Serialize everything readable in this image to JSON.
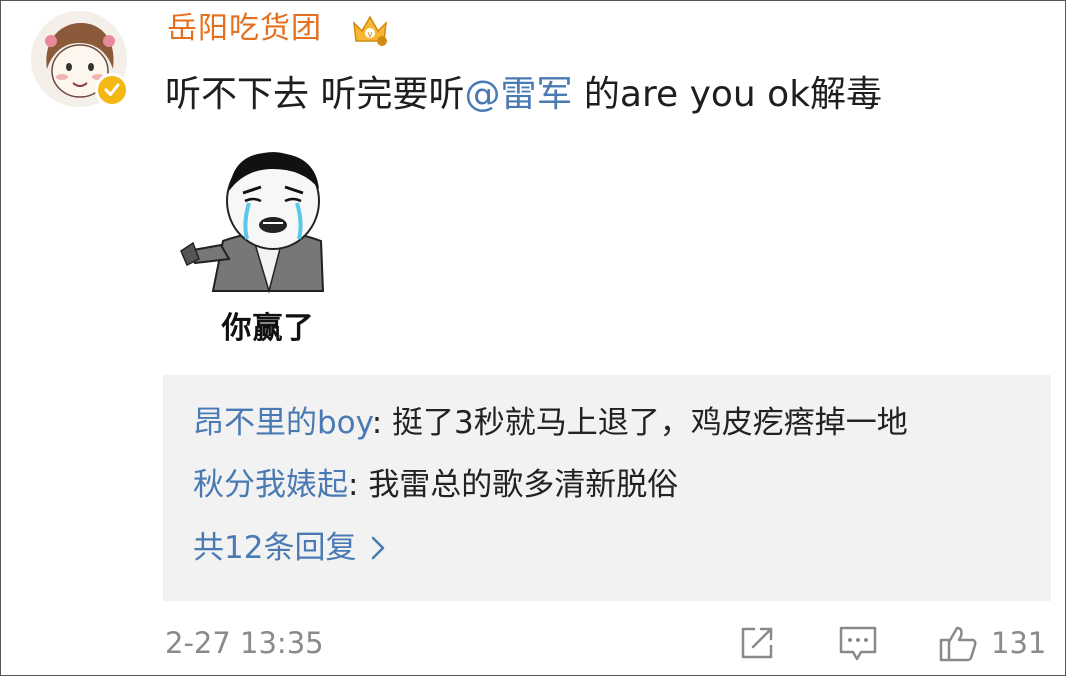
{
  "post": {
    "username": "岳阳吃货团",
    "text_prefix": "听不下去 听完要听",
    "mention": "@雷军",
    "text_suffix": " 的are you ok解毒",
    "meme_caption": "你赢了",
    "timestamp": "2-27 13:35",
    "like_count": "131"
  },
  "replies": {
    "items": [
      {
        "user": "昂不里的boy",
        "sep": ": ",
        "text": "挺了3秒就马上退了，鸡皮疙瘩掉一地"
      },
      {
        "user": "秋分我婊起",
        "sep": ": ",
        "text": "我雷总的歌多清新脱俗"
      }
    ],
    "more_label": "共12条回复"
  },
  "icons": {
    "avatar": "girl-avatar-icon",
    "verified": "verified-badge-icon",
    "crown": "vip-crown-icon",
    "more": "chevron-right-icon",
    "share": "share-icon",
    "comment": "comment-icon",
    "like": "thumbs-up-icon"
  },
  "colors": {
    "username": "#e46f1d",
    "link": "#4a7ab3",
    "reply_bg": "#f2f2f2",
    "meta_gray": "#8a8a8a",
    "verified": "#f3b814"
  }
}
